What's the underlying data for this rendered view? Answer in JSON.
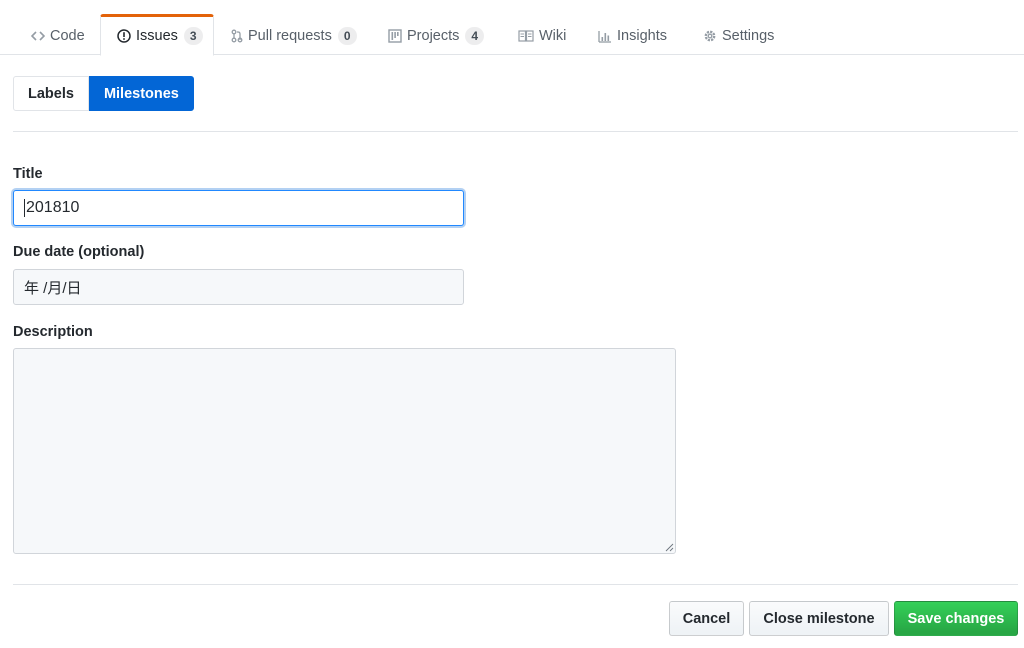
{
  "reponav": {
    "tabs": [
      {
        "label": "Code",
        "icon": "code-icon",
        "counter": null,
        "selected": false
      },
      {
        "label": "Issues",
        "icon": "issue-opened-icon",
        "counter": "3",
        "selected": true
      },
      {
        "label": "Pull requests",
        "icon": "pull-request-icon",
        "counter": "0",
        "selected": false
      },
      {
        "label": "Projects",
        "icon": "project-icon",
        "counter": "4",
        "selected": false
      },
      {
        "label": "Wiki",
        "icon": "book-icon",
        "counter": null,
        "selected": false
      },
      {
        "label": "Insights",
        "icon": "graph-icon",
        "counter": null,
        "selected": false
      },
      {
        "label": "Settings",
        "icon": "gear-icon",
        "counter": null,
        "selected": false
      }
    ],
    "accent_color": "#e36209"
  },
  "subnav": {
    "labels": "Labels",
    "milestones": "Milestones",
    "active_color": "#0366d6"
  },
  "form": {
    "title_label": "Title",
    "title_value": "201810",
    "due_date_label": "Due date (optional)",
    "due_date_placeholder": "年 /月/日",
    "description_label": "Description",
    "description_value": ""
  },
  "actions": {
    "cancel": "Cancel",
    "close_milestone": "Close milestone",
    "save_changes": "Save changes",
    "save_color": "#28a745"
  }
}
